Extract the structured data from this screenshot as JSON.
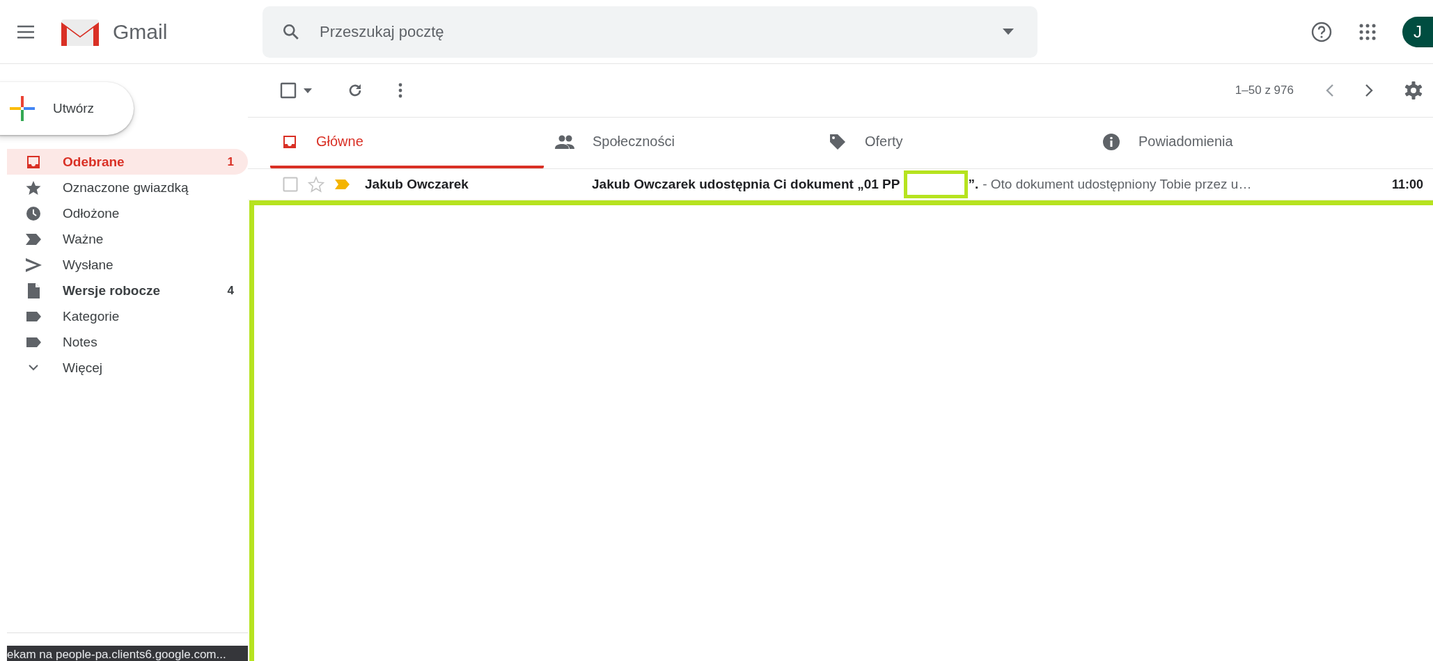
{
  "header": {
    "app_name": "Gmail",
    "search": {
      "placeholder": "Przeszukaj pocztę"
    },
    "avatar": "J"
  },
  "compose": {
    "label": "Utwórz"
  },
  "sidebar": {
    "items": [
      {
        "kind": "inbox",
        "label": "Odebrane",
        "count": "1",
        "selected": true,
        "bold": true
      },
      {
        "kind": "star",
        "label": "Oznaczone gwiazdką",
        "selected": false,
        "bold": false
      },
      {
        "kind": "clock",
        "label": "Odłożone",
        "selected": false,
        "bold": false
      },
      {
        "kind": "important",
        "label": "Ważne",
        "selected": false,
        "bold": false
      },
      {
        "kind": "send",
        "label": "Wysłane",
        "selected": false,
        "bold": false
      },
      {
        "kind": "draft",
        "label": "Wersje robocze",
        "count": "4",
        "selected": false,
        "bold": true
      },
      {
        "kind": "label",
        "label": "Kategorie",
        "selected": false,
        "bold": false
      },
      {
        "kind": "label",
        "label": "Notes",
        "selected": false,
        "bold": false
      },
      {
        "kind": "more",
        "label": "Więcej",
        "selected": false,
        "bold": false
      }
    ]
  },
  "toolbar": {
    "range": "1–50 z 976"
  },
  "tabs": [
    {
      "kind": "inbox",
      "label": "Główne",
      "selected": true
    },
    {
      "kind": "people",
      "label": "Społeczności",
      "selected": false
    },
    {
      "kind": "tag",
      "label": "Oferty",
      "selected": false
    },
    {
      "kind": "info",
      "label": "Powiadomienia",
      "selected": false
    }
  ],
  "emails": [
    {
      "sender": "Jakub Owczarek",
      "subject_start": "Jakub Owczarek udostępnia Ci dokument „01 PP",
      "subject_end": "”.",
      "snippet": "- Oto dokument udostępniony Tobie przez u…",
      "time": "11:00",
      "checked": false,
      "starred": false,
      "important": true,
      "unread": true
    }
  ],
  "status_bar": "ekam na people-pa.clients6.google.com..."
}
